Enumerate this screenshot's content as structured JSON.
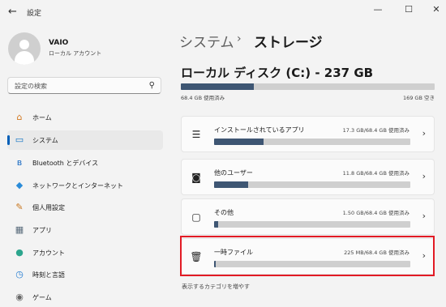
{
  "window": {
    "title": "設定",
    "back": "←",
    "controls": {
      "minimize": "—",
      "maximize": "☐",
      "close": "✕"
    }
  },
  "account": {
    "name": "VAIO",
    "type": "ローカル アカウント"
  },
  "search": {
    "placeholder": "設定の検索",
    "icon": "search-icon"
  },
  "nav": [
    {
      "label": "ホーム",
      "icon": "home-icon",
      "glyph": "⌂",
      "color": "#d2771e"
    },
    {
      "label": "システム",
      "icon": "system-icon",
      "glyph": "▭",
      "color": "#0a6fc2",
      "selected": true
    },
    {
      "label": "Bluetooth とデバイス",
      "icon": "bluetooth-icon",
      "glyph": "ʙ",
      "color": "#1769c2"
    },
    {
      "label": "ネットワークとインターネット",
      "icon": "network-icon",
      "glyph": "◆",
      "color": "#2a8bd8"
    },
    {
      "label": "個人用設定",
      "icon": "personalization-icon",
      "glyph": "✎",
      "color": "#c8751d"
    },
    {
      "label": "アプリ",
      "icon": "apps-icon",
      "glyph": "▦",
      "color": "#5a6c7c"
    },
    {
      "label": "アカウント",
      "icon": "accounts-icon",
      "glyph": "●",
      "color": "#2ca58d"
    },
    {
      "label": "時刻と言語",
      "icon": "time-language-icon",
      "glyph": "◷",
      "color": "#1f7ad1"
    },
    {
      "label": "ゲーム",
      "icon": "gaming-icon",
      "glyph": "◉",
      "color": "#666666"
    }
  ],
  "breadcrumb": {
    "parent": "システム",
    "separator": "›",
    "current": "ストレージ"
  },
  "disk": {
    "title": "ローカル ディスク (C:) - 237 GB",
    "used_label": "68.4 GB 使用済み",
    "free_label": "169 GB 空き",
    "used_fraction": 0.2886
  },
  "categories": [
    {
      "name": "インストールされているアプリ",
      "usage": "17.3 GB/68.4 GB 使用済み",
      "fraction": 0.253,
      "icon": "installed-apps-icon",
      "glyph": "☰"
    },
    {
      "name": "他のユーザー",
      "usage": "11.8 GB/68.4 GB 使用済み",
      "fraction": 0.173,
      "icon": "other-users-icon",
      "glyph": "◙"
    },
    {
      "name": "その他",
      "usage": "1.50 GB/68.4 GB 使用済み",
      "fraction": 0.022,
      "icon": "other-icon",
      "glyph": "▢"
    },
    {
      "name": "一時ファイル",
      "usage": "225 MB/68.4 GB 使用済み",
      "fraction": 0.0033,
      "icon": "trash-icon",
      "glyph": "🗑",
      "highlighted": true
    }
  ],
  "more_categories": "表示するカテゴリを増やす",
  "colors": {
    "accent": "#005fb8",
    "bar_fill": "#3e5673",
    "highlight": "#e21b25"
  }
}
